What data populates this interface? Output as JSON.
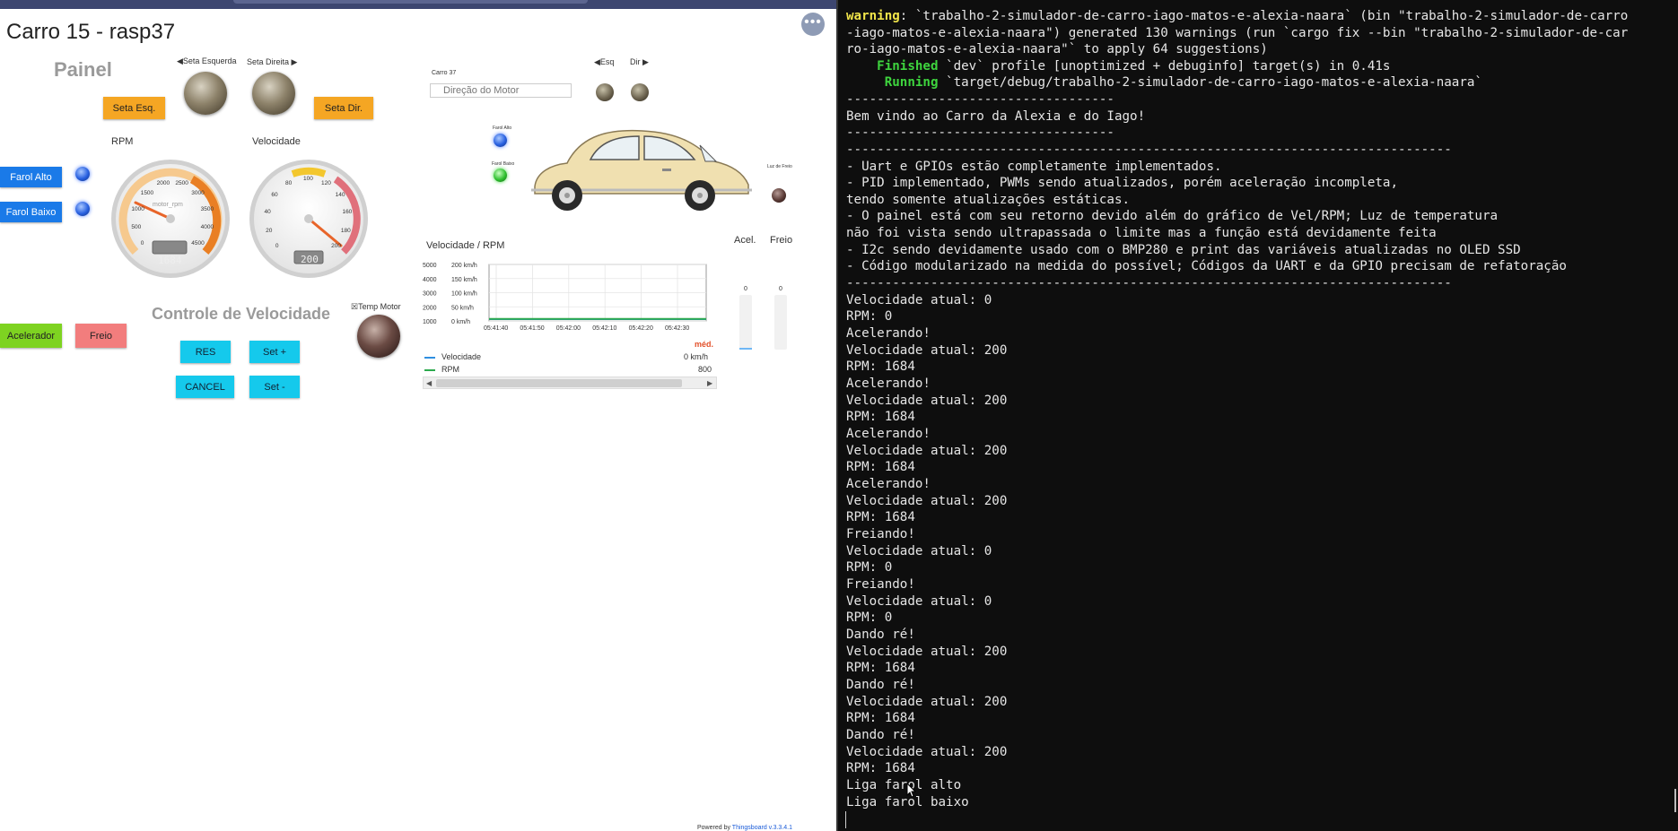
{
  "dashboard": {
    "title": "Carro 15 - rasp37",
    "more_label": "•••",
    "panel_title": "Painel",
    "seta_esquerda_label": "◀Seta Esquerda",
    "seta_direita_label": "Seta Direita ▶",
    "seta_esq_button": "Seta Esq.",
    "seta_dir_button": "Seta Dir.",
    "rpm_label": "RPM",
    "velocidade_label": "Velocidade",
    "farol_alto_button": "Farol Alto",
    "farol_baixo_button": "Farol Baixo",
    "rpm_gauge": {
      "ticks": [
        "0",
        "500",
        "1000",
        "1500",
        "2000",
        "2500",
        "3000",
        "3500",
        "4000",
        "4500"
      ],
      "unit_label": "motor_rpm",
      "value": "1684"
    },
    "speed_gauge": {
      "ticks": [
        "0",
        "20",
        "40",
        "60",
        "80",
        "100",
        "120",
        "140",
        "160",
        "180",
        "200"
      ],
      "value": "200"
    },
    "controle_title": "Controle de Velocidade",
    "temp_motor_label": "☒Temp Motor",
    "acelerador_button": "Acelerador",
    "freio_button": "Freio",
    "res_button": "RES",
    "set_plus_button": "Set +",
    "cancel_button": "CANCEL",
    "set_minus_button": "Set -",
    "car_label": "Carro 37",
    "direction_placeholder": "Direção do Motor",
    "esq_label": "◀Esq",
    "dir_label": "Dir ▶",
    "farol_alto_small": "Farol Alto",
    "farol_baixo_small": "Farol Baixo",
    "luz_de_freio_small": "Luz de Freio",
    "chart_title": "Velocidade / RPM",
    "acel_label": "Acel.",
    "freio_label": "Freio",
    "acel_value": "0",
    "freio_value": "0",
    "legend_header": "méd.",
    "legend_velocidade": "Velocidade",
    "legend_velocidade_value": "0 km/h",
    "legend_rpm": "RPM",
    "legend_rpm_value": "800",
    "powered_prefix": "Powered by ",
    "powered_link": "Thingsboard v.3.3.4.1"
  },
  "chart_data": {
    "type": "line",
    "title": "Velocidade / RPM",
    "x": [
      "05:41:40",
      "05:41:50",
      "05:42:00",
      "05:42:10",
      "05:42:20",
      "05:42:30"
    ],
    "y_left_ticks": [
      "5000",
      "4000",
      "3000",
      "2000",
      "1000"
    ],
    "y_right_ticks": [
      "200 km/h",
      "150 km/h",
      "100 km/h",
      "50 km/h",
      "0 km/h"
    ],
    "series": [
      {
        "name": "Velocidade",
        "values": [
          0,
          0,
          0,
          0,
          0,
          0
        ],
        "color": "#2f8fe0"
      },
      {
        "name": "RPM",
        "values": [
          800,
          800,
          800,
          800,
          800,
          800
        ],
        "color": "#2daa4e"
      }
    ],
    "ylim_left": [
      0,
      5000
    ],
    "ylim_right": [
      0,
      200
    ],
    "grid": true,
    "legend": "bottom"
  },
  "terminal": {
    "lines": [
      {
        "top": 12,
        "parts": [
          {
            "c": "tw",
            "t": "warning"
          },
          {
            "c": "",
            "t": ": `trabalho-2-simulador-de-carro-iago-matos-e-alexia-naara` (bin \"trabalho-2-simulador-de-carro"
          }
        ]
      },
      {
        "top": 31,
        "parts": [
          {
            "c": "",
            "t": "-iago-matos-e-alexia-naara\") generated 130 warnings (run `cargo fix --bin \"trabalho-2-simulador-de-car"
          }
        ]
      },
      {
        "top": 49,
        "parts": [
          {
            "c": "",
            "t": "ro-iago-matos-e-alexia-naara\"` to apply 64 suggestions)"
          }
        ]
      },
      {
        "top": 68,
        "parts": [
          {
            "c": "tg",
            "t": "    Finished"
          },
          {
            "c": "",
            "t": " `dev` profile [unoptimized + debuginfo] target(s) in 0.41s"
          }
        ]
      },
      {
        "top": 86,
        "parts": [
          {
            "c": "tg",
            "t": "     Running"
          },
          {
            "c": "",
            "t": " `target/debug/trabalho-2-simulador-de-carro-iago-matos-e-alexia-naara`"
          }
        ]
      },
      {
        "top": 105,
        "parts": [
          {
            "c": "",
            "t": "-----------------------------------"
          }
        ]
      },
      {
        "top": 124,
        "parts": [
          {
            "c": "",
            "t": "Bem vindo ao Carro da Alexia e do Iago!"
          }
        ]
      },
      {
        "top": 142,
        "parts": [
          {
            "c": "",
            "t": "-----------------------------------"
          }
        ]
      },
      {
        "top": 161,
        "parts": [
          {
            "c": "",
            "t": "-------------------------------------------------------------------------------"
          }
        ]
      },
      {
        "top": 180,
        "parts": [
          {
            "c": "",
            "t": "- Uart e GPIOs estão completamente implementados."
          }
        ]
      },
      {
        "top": 198,
        "parts": [
          {
            "c": "",
            "t": "- PID implementado, PWMs sendo atualizados, porém aceleração incompleta,"
          }
        ]
      },
      {
        "top": 217,
        "parts": [
          {
            "c": "",
            "t": "tendo somente atualizações estáticas."
          }
        ]
      },
      {
        "top": 235,
        "parts": [
          {
            "c": "",
            "t": "- O painel está com seu retorno devido além do gráfico de Vel/RPM; Luz de temperatura"
          }
        ]
      },
      {
        "top": 254,
        "parts": [
          {
            "c": "",
            "t": "não foi vista sendo ultrapassada o limite mas a função está devidamente feita"
          }
        ]
      },
      {
        "top": 273,
        "parts": [
          {
            "c": "",
            "t": "- I2c sendo devidamente usado com o BMP280 e print das variáveis atualizadas no OLED SSD"
          }
        ]
      },
      {
        "top": 291,
        "parts": [
          {
            "c": "",
            "t": "- Código modularizado na medida do possível; Códigos da UART e da GPIO precisam de refatoração"
          }
        ]
      },
      {
        "top": 310,
        "parts": [
          {
            "c": "",
            "t": "-------------------------------------------------------------------------------"
          }
        ]
      },
      {
        "top": 329,
        "parts": [
          {
            "c": "",
            "t": "Velocidade atual: 0"
          }
        ]
      },
      {
        "top": 347,
        "parts": [
          {
            "c": "",
            "t": "RPM: 0"
          }
        ]
      },
      {
        "top": 366,
        "parts": [
          {
            "c": "",
            "t": "Acelerando!"
          }
        ]
      },
      {
        "top": 385,
        "parts": [
          {
            "c": "",
            "t": "Velocidade atual: 200"
          }
        ]
      },
      {
        "top": 403,
        "parts": [
          {
            "c": "",
            "t": "RPM: 1684"
          }
        ]
      },
      {
        "top": 422,
        "parts": [
          {
            "c": "",
            "t": "Acelerando!"
          }
        ]
      },
      {
        "top": 441,
        "parts": [
          {
            "c": "",
            "t": "Velocidade atual: 200"
          }
        ]
      },
      {
        "top": 459,
        "parts": [
          {
            "c": "",
            "t": "RPM: 1684"
          }
        ]
      },
      {
        "top": 478,
        "parts": [
          {
            "c": "",
            "t": "Acelerando!"
          }
        ]
      },
      {
        "top": 497,
        "parts": [
          {
            "c": "",
            "t": "Velocidade atual: 200"
          }
        ]
      },
      {
        "top": 515,
        "parts": [
          {
            "c": "",
            "t": "RPM: 1684"
          }
        ]
      },
      {
        "top": 534,
        "parts": [
          {
            "c": "",
            "t": "Acelerando!"
          }
        ]
      },
      {
        "top": 553,
        "parts": [
          {
            "c": "",
            "t": "Velocidade atual: 200"
          }
        ]
      },
      {
        "top": 571,
        "parts": [
          {
            "c": "",
            "t": "RPM: 1684"
          }
        ]
      },
      {
        "top": 590,
        "parts": [
          {
            "c": "",
            "t": "Freiando!"
          }
        ]
      },
      {
        "top": 609,
        "parts": [
          {
            "c": "",
            "t": "Velocidade atual: 0"
          }
        ]
      },
      {
        "top": 627,
        "parts": [
          {
            "c": "",
            "t": "RPM: 0"
          }
        ]
      },
      {
        "top": 646,
        "parts": [
          {
            "c": "",
            "t": "Freiando!"
          }
        ]
      },
      {
        "top": 665,
        "parts": [
          {
            "c": "",
            "t": "Velocidade atual: 0"
          }
        ]
      },
      {
        "top": 683,
        "parts": [
          {
            "c": "",
            "t": "RPM: 0"
          }
        ]
      },
      {
        "top": 702,
        "parts": [
          {
            "c": "",
            "t": "Dando ré!"
          }
        ]
      },
      {
        "top": 721,
        "parts": [
          {
            "c": "",
            "t": "Velocidade atual: 200"
          }
        ]
      },
      {
        "top": 739,
        "parts": [
          {
            "c": "",
            "t": "RPM: 1684"
          }
        ]
      },
      {
        "top": 758,
        "parts": [
          {
            "c": "",
            "t": "Dando ré!"
          }
        ]
      },
      {
        "top": 777,
        "parts": [
          {
            "c": "",
            "t": "Velocidade atual: 200"
          }
        ]
      },
      {
        "top": 795,
        "parts": [
          {
            "c": "",
            "t": "RPM: 1684"
          }
        ]
      },
      {
        "top": 814,
        "parts": [
          {
            "c": "",
            "t": "Dando ré!"
          }
        ]
      },
      {
        "top": 833,
        "parts": [
          {
            "c": "",
            "t": "Velocidade atual: 200"
          }
        ]
      },
      {
        "top": 851,
        "parts": [
          {
            "c": "",
            "t": "RPM: 1684"
          }
        ]
      },
      {
        "top": 870,
        "parts": [
          {
            "c": "",
            "t": "Liga farol alto"
          }
        ]
      },
      {
        "top": 889,
        "parts": [
          {
            "c": "",
            "t": "Liga farol baixo"
          }
        ]
      }
    ]
  }
}
